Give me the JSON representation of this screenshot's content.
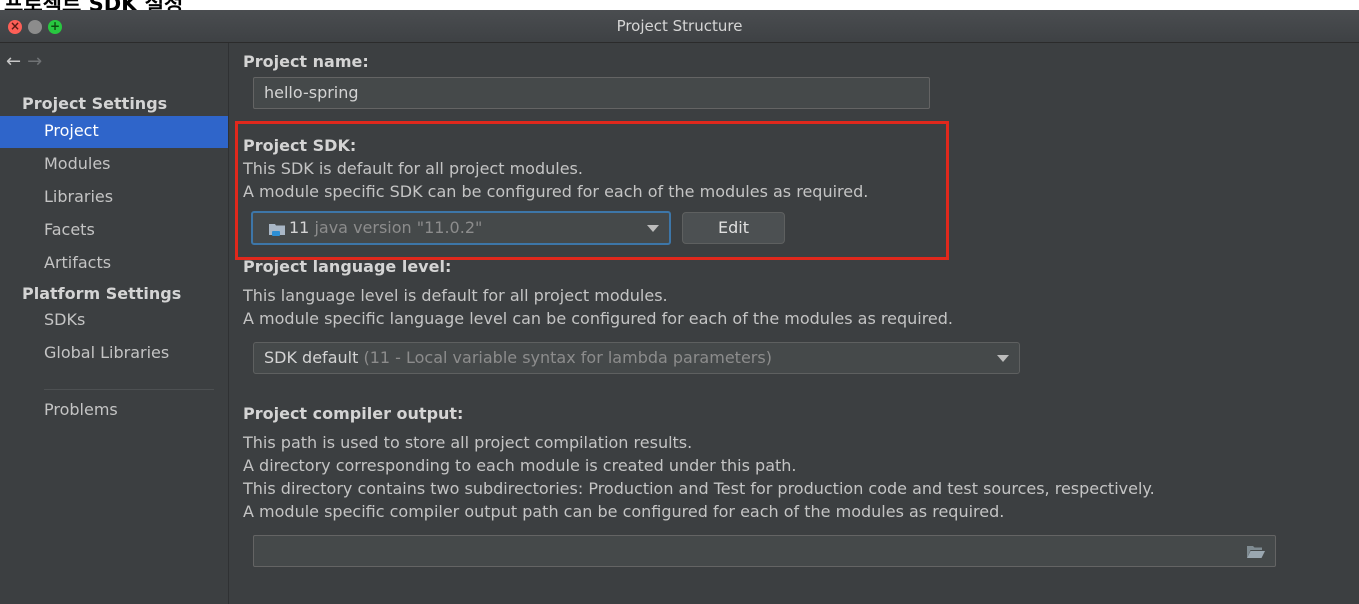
{
  "page_heading": "프로젝트 SDK 설정",
  "window": {
    "title": "Project Structure"
  },
  "sidebar": {
    "nav_back": "←",
    "nav_forward": "→",
    "project_settings_header": "Project Settings",
    "project_settings_items": [
      {
        "label": "Project",
        "active": true
      },
      {
        "label": "Modules"
      },
      {
        "label": "Libraries"
      },
      {
        "label": "Facets"
      },
      {
        "label": "Artifacts"
      }
    ],
    "platform_settings_header": "Platform Settings",
    "platform_settings_items": [
      {
        "label": "SDKs"
      },
      {
        "label": "Global Libraries"
      }
    ],
    "problems": "Problems"
  },
  "project_name": {
    "label": "Project name:",
    "value": "hello-spring"
  },
  "project_sdk": {
    "label": "Project SDK:",
    "desc_line1": "This SDK is default for all project modules.",
    "desc_line2": "A module specific SDK can be configured for each of the modules as required.",
    "selected_value": "11",
    "selected_hint": "java version \"11.0.2\"",
    "edit_label": "Edit",
    "icon": "folder-icon"
  },
  "language_level": {
    "label": "Project language level:",
    "desc_line1": "This language level is default for all project modules.",
    "desc_line2": "A module specific language level can be configured for each of the modules as required.",
    "selected_value": "SDK default",
    "selected_hint": "(11 - Local variable syntax for lambda parameters)"
  },
  "compiler_output": {
    "label": "Project compiler output:",
    "desc_line1": "This path is used to store all project compilation results.",
    "desc_line2": "A directory corresponding to each module is created under this path.",
    "desc_line3": "This directory contains two subdirectories: Production and Test for production code and test sources, respectively.",
    "desc_line4": "A module specific compiler output path can be configured for each of the modules as required.",
    "path_value": "",
    "browse_icon": "folder-open-icon"
  },
  "colors": {
    "background": "#3c3f41",
    "selection": "#2f65ca",
    "highlight_box": "#e0281c",
    "focus_border": "#3d76a8"
  }
}
